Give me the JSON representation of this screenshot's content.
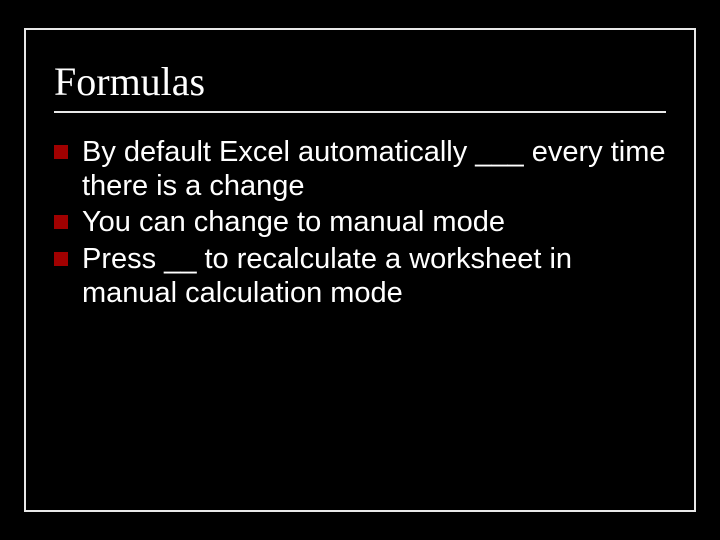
{
  "slide": {
    "title": "Formulas",
    "bullets": [
      "By default Excel automatically ___ every time there is a change",
      "You can change to manual mode",
      "Press __ to recalculate a worksheet in manual calculation mode"
    ]
  },
  "colors": {
    "background": "#000000",
    "frame": "#e8e8e8",
    "text": "#ffffff",
    "bullet": "#a00000"
  }
}
